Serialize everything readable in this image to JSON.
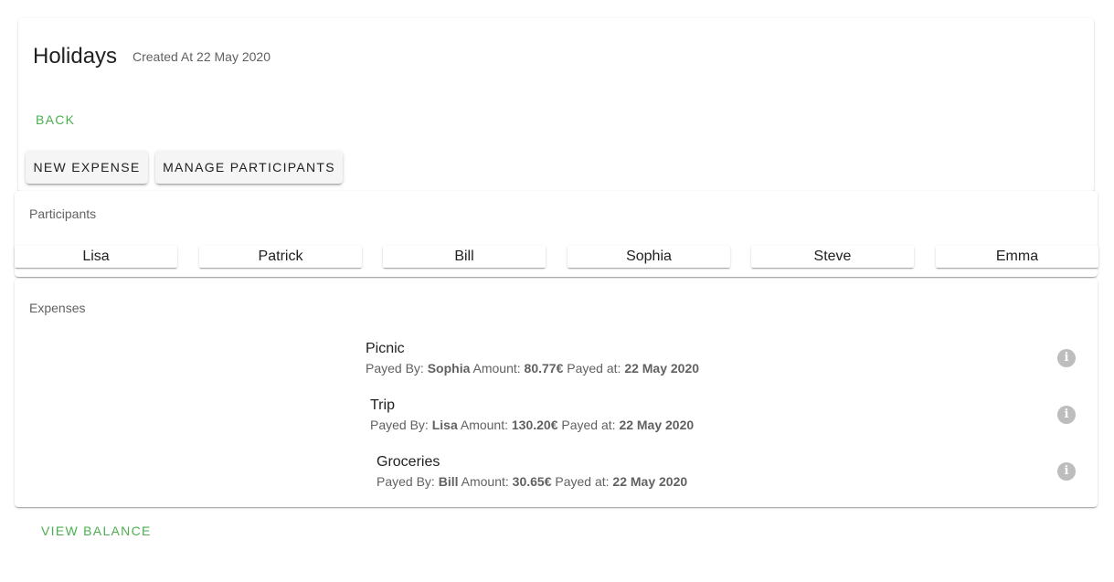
{
  "header": {
    "title": "Holidays",
    "created_at": "Created At 22 May 2020"
  },
  "actions": {
    "back_label": "BACK",
    "new_expense_label": "NEW EXPENSE",
    "manage_participants_label": "MANAGE PARTICIPANTS",
    "view_balance_label": "VIEW BALANCE"
  },
  "participants": {
    "title": "Participants",
    "items": [
      "Lisa",
      "Patrick",
      "Bill",
      "Sophia",
      "Steve",
      "Emma"
    ]
  },
  "expenses": {
    "title": "Expenses",
    "payed_by_label": "Payed By:",
    "amount_label": "Amount:",
    "payed_at_label": "Payed at:",
    "items": [
      {
        "name": "Picnic",
        "payer": "Sophia",
        "amount": "80.77€",
        "date": "22 May 2020",
        "icon": "info-icon"
      },
      {
        "name": "Trip",
        "payer": "Lisa",
        "amount": "130.20€",
        "date": "22 May 2020",
        "icon": "info-icon"
      },
      {
        "name": "Groceries",
        "payer": "Bill",
        "amount": "30.65€",
        "date": "22 May 2020",
        "icon": "info-icon"
      }
    ]
  },
  "colors": {
    "accent": "#4caf50",
    "info_icon": "#bdbdbd"
  }
}
